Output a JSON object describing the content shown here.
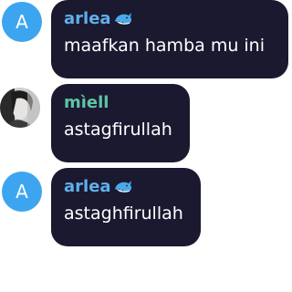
{
  "colors": {
    "bubble_bg": "#1b1930",
    "avatar_letter_bg": "#3da5f0",
    "name_arlea": "#5fb0ea",
    "name_miell": "#5ec4a4",
    "message_text": "#ffffff"
  },
  "messages": [
    {
      "author": "arlea",
      "avatar_letter": "A",
      "avatar_type": "letter",
      "name_icon": "dolphin-icon",
      "text": "maafkan hamba mu ini"
    },
    {
      "author": "mìell",
      "avatar_type": "photo",
      "text": "astagfirullah"
    },
    {
      "author": "arlea",
      "avatar_letter": "A",
      "avatar_type": "letter",
      "name_icon": "dolphin-icon",
      "text": "astaghfirullah"
    }
  ]
}
